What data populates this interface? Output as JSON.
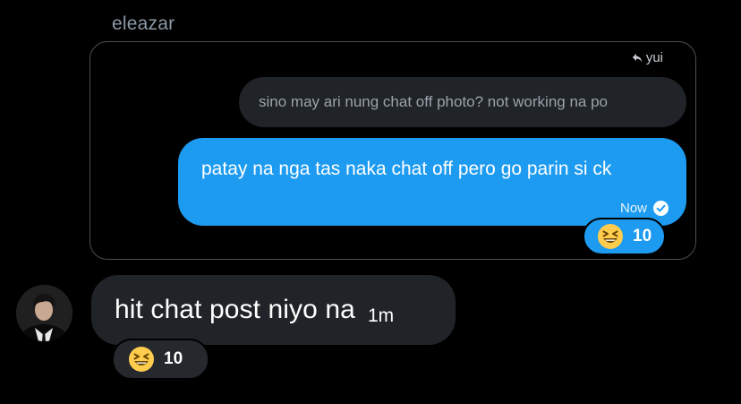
{
  "message_group": {
    "sender_name": "eleazar",
    "reply_context": {
      "reply_to_label": "yui",
      "reply_icon": "reply-arrow-icon",
      "quoted_message": "sino may ari nung chat off photo? not working na po"
    },
    "own_message": {
      "text": "patay na nga tas naka chat off pero go parin si ck",
      "timestamp": "Now",
      "status_icon": "check-circle-icon",
      "reaction": {
        "emoji": "grinning-squinting-face-icon",
        "count": "10"
      }
    },
    "received_message": {
      "avatar": "user-avatar",
      "text": "hit chat post niyo na",
      "time": "1m",
      "reaction": {
        "emoji": "grinning-squinting-face-icon",
        "count": "10"
      }
    }
  },
  "colors": {
    "background": "#000000",
    "own_bubble": "#1d9bf0",
    "received_bubble": "#202327",
    "muted_text": "#8b98a5"
  }
}
